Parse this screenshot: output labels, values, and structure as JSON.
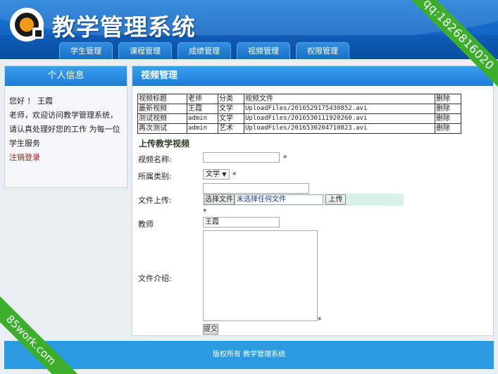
{
  "header": {
    "title": "教学管理系统",
    "nav": [
      "学生管理",
      "课程管理",
      "成绩管理",
      "视频管理",
      "权限管理"
    ],
    "watermark": "qq:1826816020"
  },
  "sidebar": {
    "title": "个人信息",
    "greeting": "您好 ！ 王霞",
    "message": "老师，欢迎访问教学管理系统，请认真处理好您的工作 为每一位学生服务",
    "logout": "注销登录"
  },
  "main": {
    "title": "视频管理",
    "table": {
      "headers": [
        "视频标题",
        "老师",
        "分类",
        "视频文件",
        "删除"
      ],
      "rows": [
        [
          "最新视频",
          "王霞",
          "文学",
          "UploadFiles/2016529175430852.avi",
          "删除"
        ],
        [
          "测试视频",
          "admin",
          "文学",
          "UploadFiles/2016530111920260.avi",
          "删除"
        ],
        [
          "再次测试",
          "admin",
          "艺术",
          "UploadFiles/2016530204710823.avi",
          "删除"
        ]
      ]
    },
    "upload": {
      "title": "上传教学视频",
      "name_label": "视频名称:",
      "name_value": "",
      "category_label": "所属类别:",
      "category_value": "文学",
      "file_label": "文件上传:",
      "choose_file": "选择文件",
      "no_file": "未选择任何文件",
      "upload_button": "上传",
      "teacher_label": "教师",
      "teacher_value": "王霞",
      "intro_label": "文件介绍:",
      "submit": "提交",
      "required_mark": "*"
    }
  },
  "footer": {
    "text": "版权所有  教学管理系统",
    "watermark": "85work.com"
  },
  "colors": {
    "header_blue": "#1266c4",
    "panel_blue": "#1c7cd7",
    "footer_blue": "#2a9be0",
    "badge_green": "#3cae2c"
  }
}
